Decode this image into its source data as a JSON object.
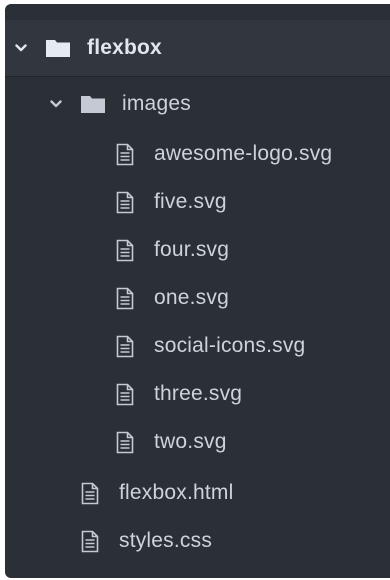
{
  "tree": {
    "root": {
      "name": "flexbox",
      "expanded": true,
      "chevron_icon": "chevron-down-icon",
      "icon": "folder-icon"
    },
    "folder_images": {
      "name": "images",
      "expanded": true,
      "chevron_icon": "chevron-down-icon",
      "icon": "folder-icon"
    },
    "image_files": [
      {
        "name": "awesome-logo.svg",
        "icon": "file-icon"
      },
      {
        "name": "five.svg",
        "icon": "file-icon"
      },
      {
        "name": "four.svg",
        "icon": "file-icon"
      },
      {
        "name": "one.svg",
        "icon": "file-icon"
      },
      {
        "name": "social-icons.svg",
        "icon": "file-icon"
      },
      {
        "name": "three.svg",
        "icon": "file-icon"
      },
      {
        "name": "two.svg",
        "icon": "file-icon"
      }
    ],
    "root_files": [
      {
        "name": "flexbox.html",
        "icon": "file-icon"
      },
      {
        "name": "styles.css",
        "icon": "file-icon"
      }
    ]
  },
  "colors": {
    "panel_background": "#2b2f36",
    "selected_row_background": "#32363e",
    "text": "#cdd3dc",
    "icon": "#c4cad3"
  }
}
